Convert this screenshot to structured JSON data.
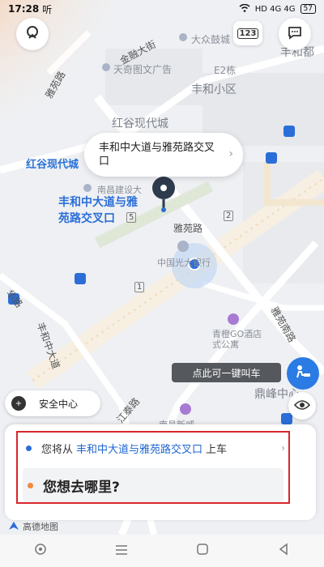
{
  "status_bar": {
    "time": "17:28",
    "carrier": "听",
    "signals": "HD 4G 4G",
    "battery": "57"
  },
  "map": {
    "pois": {
      "dazhong": "大众鼓城",
      "jinrong_street": "金融大街",
      "fenghe_du": "丰和都",
      "e2": "E2栋",
      "yaoyuan_top": "雅苑路",
      "tianqi": "天奇图文广告",
      "fenghe_xiaoqu": "丰和小区",
      "honggu_modern": "红谷现代城",
      "honggu_modern_blue": "红谷现代城",
      "nanchang_jianshe": "南昌建设大",
      "yaoyuan_road": "雅苑路",
      "route_2": "2",
      "route_5": "5",
      "route_1": "1",
      "zhongguo_bank": "中国光大银行",
      "hua_road": "华路",
      "fenghe_zhong_dadao": "丰和中大道",
      "qingcheng_go": "青橙GO酒店式公寓",
      "yaoyuan_south": "雅苑南路",
      "jiangtai_road": "江泰路",
      "dingfeng": "鼎峰中心",
      "nanchang_xinwei": "南昌新威"
    },
    "pickup_callout": "丰和中大道与雅苑路交叉口",
    "pin_label_line1": "丰和中大道与雅",
    "pin_label_line2": "苑路交叉口"
  },
  "top_buttons": {
    "plate": "123"
  },
  "tooltip": "点此可一键叫车",
  "safety_center": "安全中心",
  "card": {
    "pickup_prefix": "您将从",
    "pickup_place": "丰和中大道与雅苑路交叉口",
    "pickup_suffix": "上车",
    "destination_prompt": "您想去哪里?"
  },
  "amap_logo": "高德地图",
  "colors": {
    "accent_blue": "#2b6ed8",
    "highlight_red": "#d8262c",
    "origin_orange": "#f08a3c"
  }
}
